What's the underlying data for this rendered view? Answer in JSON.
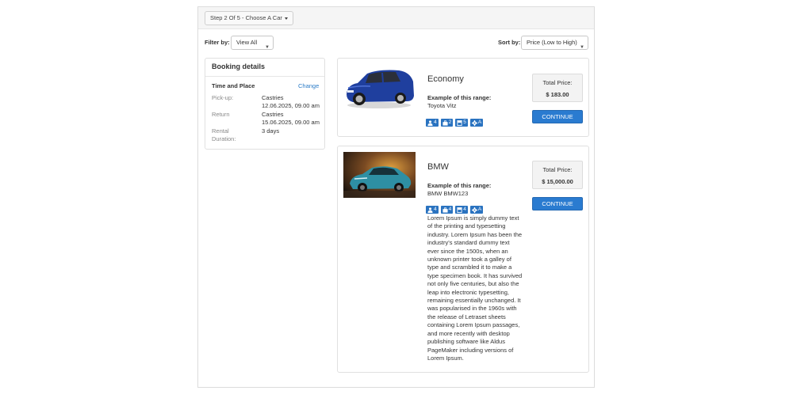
{
  "header": {
    "step_label": "Step 2 Of 5 - Choose A Car"
  },
  "filter": {
    "label": "Filter by:",
    "value": "View All"
  },
  "sort": {
    "label": "Sort by:",
    "value": "Price (Low to High)"
  },
  "booking": {
    "title": "Booking details",
    "section_title": "Time and Place",
    "change_label": "Change",
    "pickup_label": "Pick-up:",
    "pickup_place": "Castries",
    "pickup_date": "12.06.2025, 09.00 am",
    "return_label": "Return",
    "return_place": "Castries",
    "return_date": "15.06.2025, 09.00 am",
    "rental_label_1": "Rental",
    "rental_label_2": "Duration:",
    "rental_value": "3 days"
  },
  "cars": [
    {
      "name": "Economy",
      "example_label": "Example of this range:",
      "example_value": "Toyota Vitz",
      "badges": [
        {
          "icon": "person-icon",
          "value": "4"
        },
        {
          "icon": "suitcase-icon",
          "value": "2"
        },
        {
          "icon": "door-icon",
          "value": "5"
        },
        {
          "icon": "gear-icon",
          "value": "A"
        }
      ],
      "price_label": "Total Price:",
      "price": "$ 183.00",
      "button_label": "CONTINUE"
    },
    {
      "name": "BMW",
      "example_label": "Example of this range:",
      "example_value": "BMW BMW123",
      "badges": [
        {
          "icon": "person-icon",
          "value": "4"
        },
        {
          "icon": "suitcase-icon",
          "value": "4"
        },
        {
          "icon": "door-icon",
          "value": "4"
        },
        {
          "icon": "gear-icon",
          "value": "A"
        }
      ],
      "price_label": "Total Price:",
      "price": "$ 15,000.00",
      "button_label": "CONTINUE",
      "description_lines": [
        "Lorem Ipsum is simply dummy text",
        "of the printing and typesetting",
        "industry. Lorem Ipsum has been the",
        "industry's standard dummy text",
        "ever since the 1500s, when an",
        "unknown printer took a galley of",
        "type and scrambled it to make a",
        "type specimen book. It has survived",
        "not only five centuries, but also the",
        "leap into electronic typesetting,",
        "remaining essentially unchanged. It",
        "was popularised in the 1960s with",
        "the release of Letraset sheets",
        "containing Lorem Ipsum passages,",
        "and more recently with desktop",
        "publishing software like Aldus",
        "PageMaker including versions of",
        "Lorem Ipsum."
      ]
    }
  ],
  "colors": {
    "accent": "#2a7bd0",
    "badge": "#2a73c0",
    "link": "#2a7bc7"
  }
}
